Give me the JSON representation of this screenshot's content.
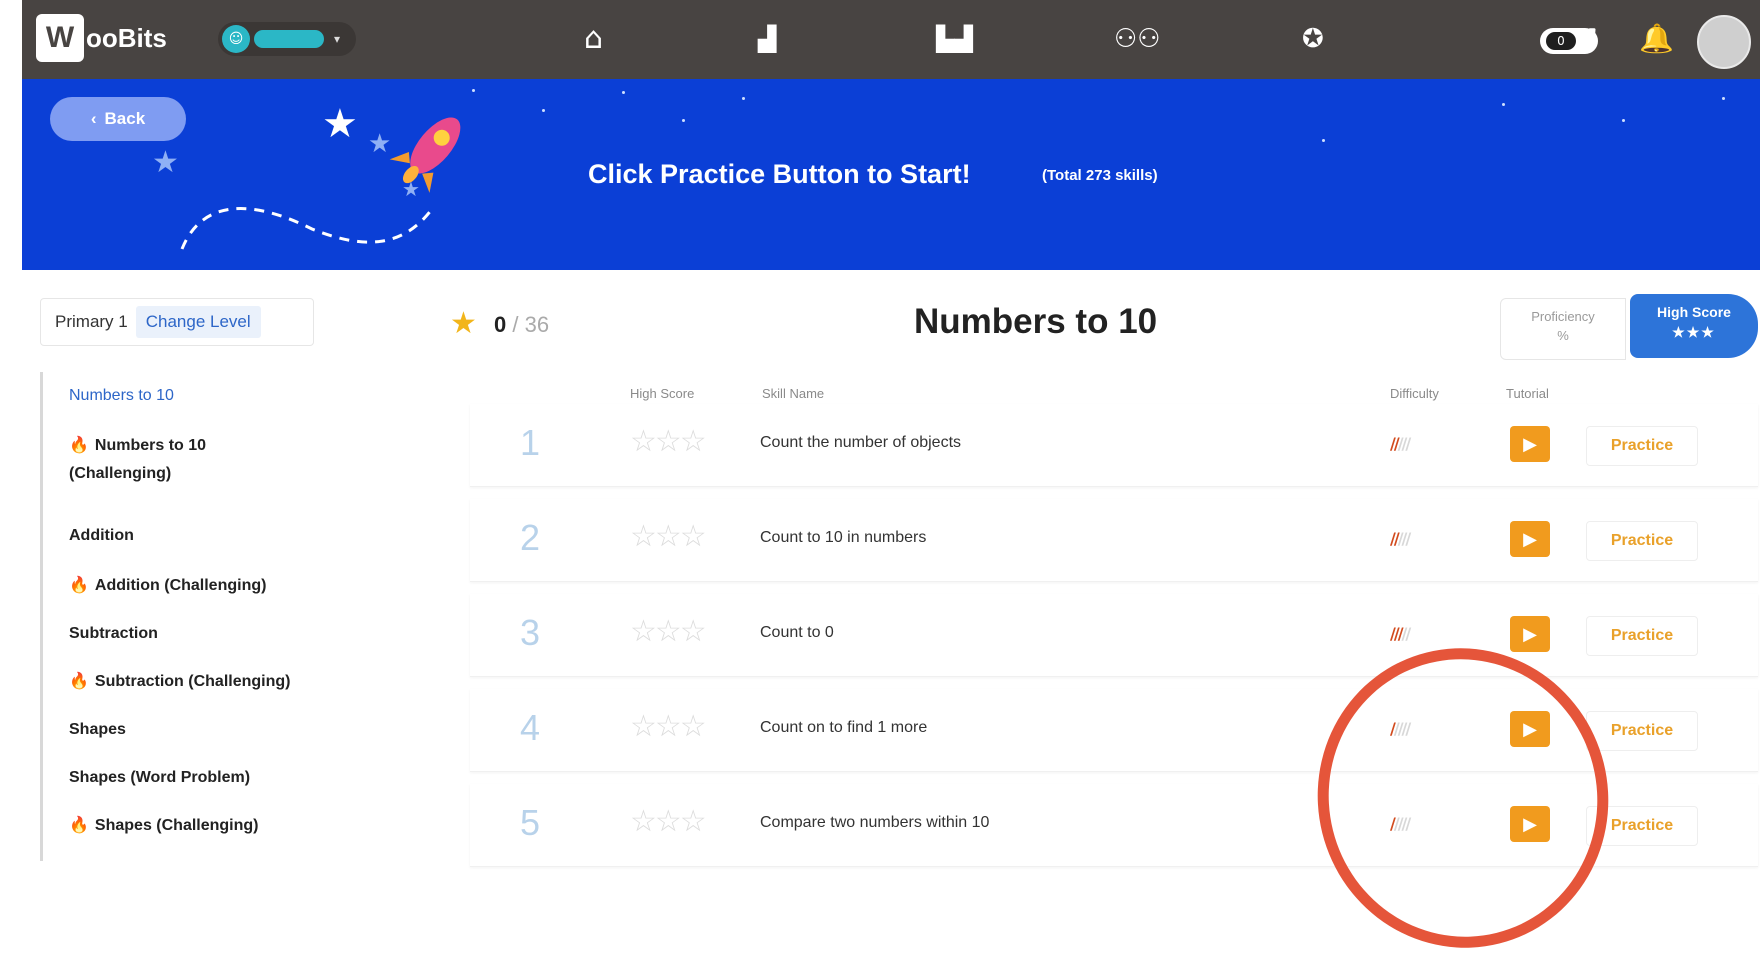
{
  "topbar": {
    "brand_initial": "W",
    "brand_text": "ooBits",
    "nav_icons": [
      "home-icon",
      "chart-icon",
      "leaderboard-icon",
      "friends-icon",
      "award-icon"
    ],
    "toggle_value": "0"
  },
  "banner": {
    "back_label": "Back",
    "title": "Click Practice Button to Start!",
    "subtitle": "(Total 273 skills)"
  },
  "level": {
    "current": "Primary 1",
    "change_label": "Change Level"
  },
  "sidebar": {
    "items": [
      {
        "label": "Numbers to 10",
        "fire": false,
        "active": true
      },
      {
        "label": "Numbers to 10",
        "label2": "(Challenging)",
        "fire": true
      },
      {
        "label": "Addition",
        "fire": false
      },
      {
        "label": "Addition (Challenging)",
        "fire": true
      },
      {
        "label": "Subtraction",
        "fire": false
      },
      {
        "label": "Subtraction (Challenging)",
        "fire": true
      },
      {
        "label": "Shapes",
        "fire": false
      },
      {
        "label": "Shapes (Word Problem)",
        "fire": false
      },
      {
        "label": "Shapes (Challenging)",
        "fire": true
      }
    ]
  },
  "main": {
    "score_earned": "0",
    "score_total": "/ 36",
    "section_title": "Numbers to 10",
    "sort_proficiency": [
      "Proficiency",
      "%"
    ],
    "sort_high_score": [
      "High Score",
      "★★★"
    ],
    "columns": {
      "high_score": "High Score",
      "skill_name": "Skill Name",
      "difficulty": "Difficulty",
      "tutorial": "Tutorial"
    },
    "rows": [
      {
        "num": "1",
        "skill": "Count the number of objects",
        "difficulty": 2,
        "practice": "Practice"
      },
      {
        "num": "2",
        "skill": "Count to 10 in numbers",
        "difficulty": 2,
        "practice": "Practice"
      },
      {
        "num": "3",
        "skill": "Count to 0",
        "difficulty": 3,
        "practice": "Practice"
      },
      {
        "num": "4",
        "skill": "Count on to find 1 more",
        "difficulty": 1,
        "practice": "Practice"
      },
      {
        "num": "5",
        "skill": "Compare two numbers within 10",
        "difficulty": 1,
        "practice": "Practice"
      }
    ]
  },
  "colors": {
    "nav_bg": "#484442",
    "banner_bg": "#0b3fd6",
    "accent_blue": "#2d74d9",
    "tutorial_orange": "#f19b1e",
    "annotation_red": "#e5553a"
  }
}
